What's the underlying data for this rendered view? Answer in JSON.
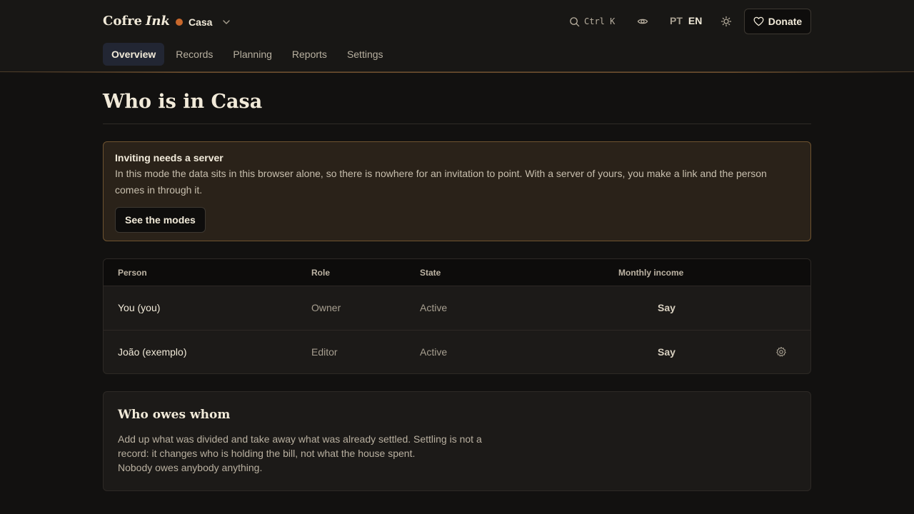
{
  "header": {
    "brand": {
      "word": "Cofre",
      "accent": "Ink"
    },
    "house": {
      "name": "Casa",
      "dot_color": "#c8682c",
      "icon": "chevron-down-icon"
    },
    "search": {
      "shortcut": "Ctrl K",
      "icon": "search-icon"
    },
    "privacy_icon": "eye-icon",
    "languages": {
      "pt": "PT",
      "en": "EN",
      "selected": "EN"
    },
    "theme_icon": "sun-icon",
    "donate": {
      "label": "Donate",
      "icon": "heart-icon"
    }
  },
  "nav": {
    "tabs": [
      {
        "label": "Overview",
        "active": true
      },
      {
        "label": "Records"
      },
      {
        "label": "Planning"
      },
      {
        "label": "Reports"
      },
      {
        "label": "Settings"
      }
    ]
  },
  "page": {
    "title": "Who is in Casa"
  },
  "notice": {
    "title": "Inviting needs a server",
    "body": "In this mode the data sits in this browser alone, so there is nowhere for an invitation to point. With a server of yours, you make a link and the person comes in through it.",
    "button": "See the modes"
  },
  "members": {
    "columns": [
      "Person",
      "Role",
      "State",
      "Monthly income"
    ],
    "rows": [
      {
        "person": "You (you)",
        "role": "Owner",
        "state": "Active",
        "income": "Say"
      },
      {
        "person": "João (exemplo)",
        "role": "Editor",
        "state": "Active",
        "income": "Say",
        "settings_icon": "gear-icon"
      }
    ]
  },
  "owes": {
    "title": "Who owes whom",
    "line1": "Add up what was divided and take away what was already settled. Settling is not a record: it changes who is holding the bill, not what the house spent.",
    "line2": "Nobody owes anybody anything."
  },
  "colors": {
    "accent_dot": "#c8682c",
    "active_tab": "#222633",
    "notice_border": "#6e5330"
  }
}
